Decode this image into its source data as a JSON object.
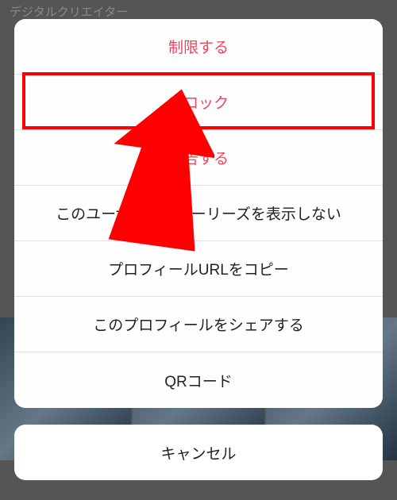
{
  "background": {
    "profile_type": "デジタルクリエイター"
  },
  "actions": {
    "restrict": "制限する",
    "block": "ブロック",
    "report": "報告する",
    "hide_story": "このユーザーのストーリーズを表示しない",
    "copy_url": "プロフィールURLをコピー",
    "share_profile": "このプロフィールをシェアする",
    "qr_code": "QRコード"
  },
  "cancel": "キャンセル"
}
